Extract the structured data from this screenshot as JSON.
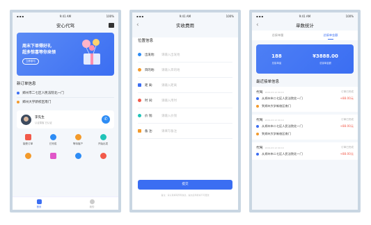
{
  "status": {
    "time": "9:41 AM",
    "battery": "100%"
  },
  "home": {
    "title": "安心代驾",
    "banner": {
      "line1": "周末下单得好礼",
      "line2": "超多惊喜等你来领",
      "button": "立即参与"
    },
    "new_orders_title": "新订单信息",
    "from": "郑州市二七区人民法院北一门",
    "to": "郑州大学新校区南门",
    "user": {
      "name": "李先生",
      "sub": "认证乘客 已认证"
    },
    "grid": [
      {
        "label": "接受订单",
        "color": "#f25a4a"
      },
      {
        "label": "已完成",
        "color": "#2d8cf5"
      },
      {
        "label": "等待客户",
        "color": "#f39a2b"
      },
      {
        "label": "开始出发",
        "color": "#20c3b8"
      },
      {
        "label": "",
        "color": "#f39a2b"
      },
      {
        "label": "",
        "color": "#e056c8"
      },
      {
        "label": "",
        "color": "#2d8cf5"
      },
      {
        "label": "",
        "color": "#f25a4a"
      }
    ],
    "tabs": [
      "首页",
      "我的"
    ]
  },
  "fee": {
    "title": "实收费用",
    "section": "位置信息",
    "rows": [
      {
        "label": "出发地:",
        "placeholder": "请输入出发地",
        "color": "#2d8cf5"
      },
      {
        "label": "目的地:",
        "placeholder": "请输入目的地",
        "color": "#f39a2b"
      },
      {
        "label": "距  离:",
        "placeholder": "请输入距离",
        "color": "#3b6ef2"
      },
      {
        "label": "时  间:",
        "placeholder": "请输入用时",
        "color": "#f25a4a"
      },
      {
        "label": "价  钱:",
        "placeholder": "请输入价钱",
        "color": "#20c3b8"
      },
      {
        "label": "备  注:",
        "placeholder": "请填写备注",
        "color": "#f39a2b"
      }
    ],
    "submit": "提交",
    "note": "备注：请认真填写所有信息，提交后司机将不可更改"
  },
  "stats": {
    "title": "单数统计",
    "tabs": [
      "总接单量",
      "总接单金额"
    ],
    "count": "188",
    "count_label": "总接单量",
    "amount": "¥3888.00",
    "amount_label": "总接单金额",
    "recent_title": "最近接单信息",
    "orders": [
      {
        "type": "代驾",
        "time": "2019-03-12 09:10",
        "status": "订单已完成",
        "from": "从郑州市二七区人民法院北一门",
        "price": "+88.00元",
        "to": "到郑州大学新校区南门"
      },
      {
        "type": "代驾",
        "time": "2019-03-12 09:10",
        "status": "订单已完成",
        "from": "从郑州市二七区人民法院北一门",
        "price": "+88.00元",
        "to": "到郑州大学新校区南门"
      },
      {
        "type": "代驾",
        "time": "2019-03-12 09:10",
        "status": "订单已完成",
        "from": "从郑州市二七区人民法院北一门",
        "price": "+88.00元",
        "to": ""
      }
    ]
  }
}
